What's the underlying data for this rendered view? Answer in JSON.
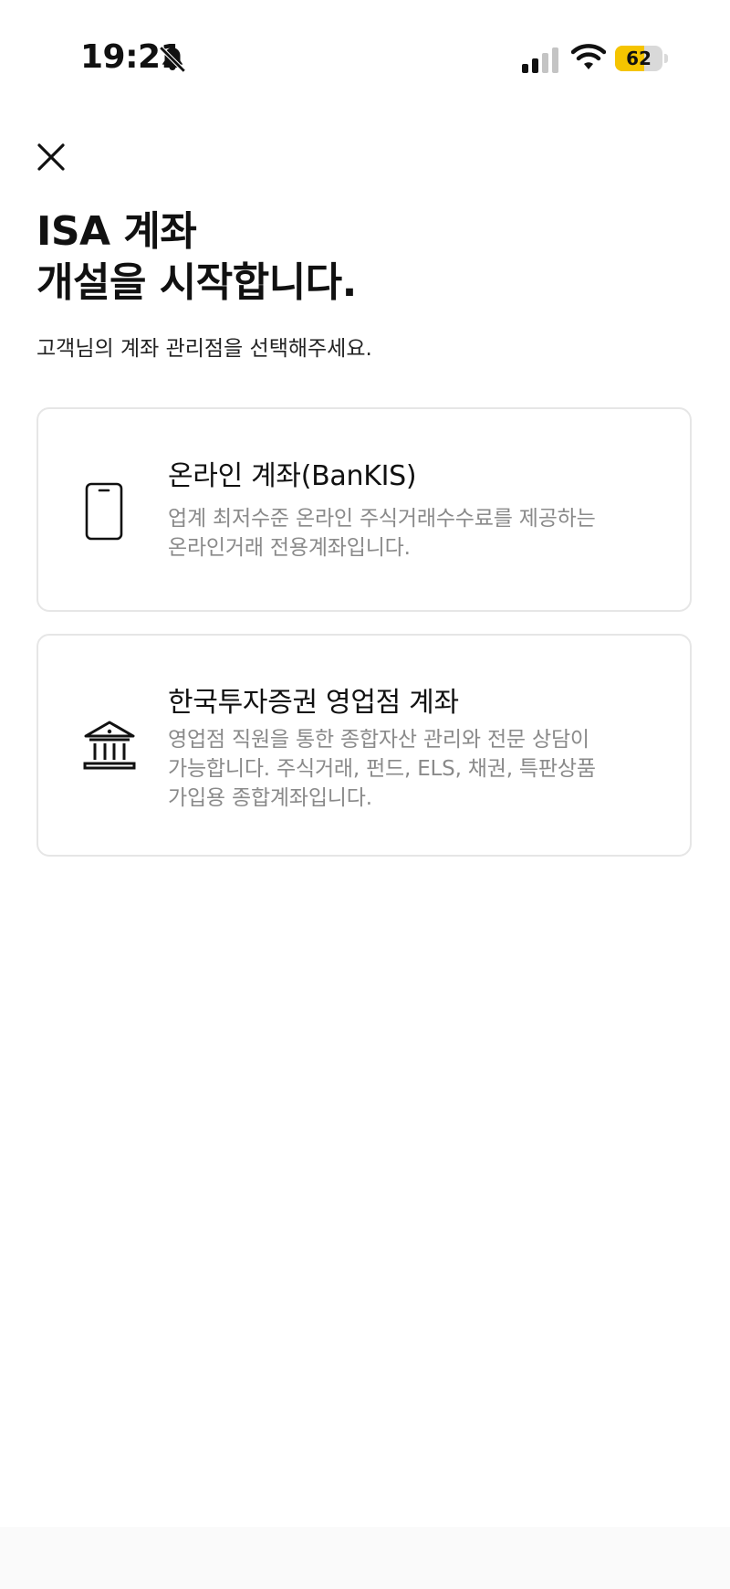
{
  "status_bar": {
    "time": "19:21",
    "battery_level": 62,
    "battery_label": "62",
    "battery_color": "#f5c400",
    "icons": [
      "bell-slash-icon",
      "cellular-signal-icon",
      "wifi-icon",
      "battery-icon"
    ]
  },
  "header": {
    "close_icon": "close-icon",
    "title_line1": "ISA 계좌",
    "title_line2": "개설을 시작합니다.",
    "subtitle": "고객님의 계좌 관리점을 선택해주세요."
  },
  "options": [
    {
      "icon": "smartphone-icon",
      "title": "온라인 계좌(BanKIS)",
      "desc_line1": "업계 최저수준 온라인 주식거래수수료를 제공하는",
      "desc_line2": "온라인거래 전용계좌입니다."
    },
    {
      "icon": "bank-building-icon",
      "title": "한국투자증권 영업점 계좌",
      "desc_line1": "영업점 직원을 통한 종합자산 관리와 전문 상담이",
      "desc_line2": "가능합니다. 주식거래, 펀드, ELS, 채권, 특판상품",
      "desc_line3": "가입용 종합계좌입니다."
    }
  ]
}
